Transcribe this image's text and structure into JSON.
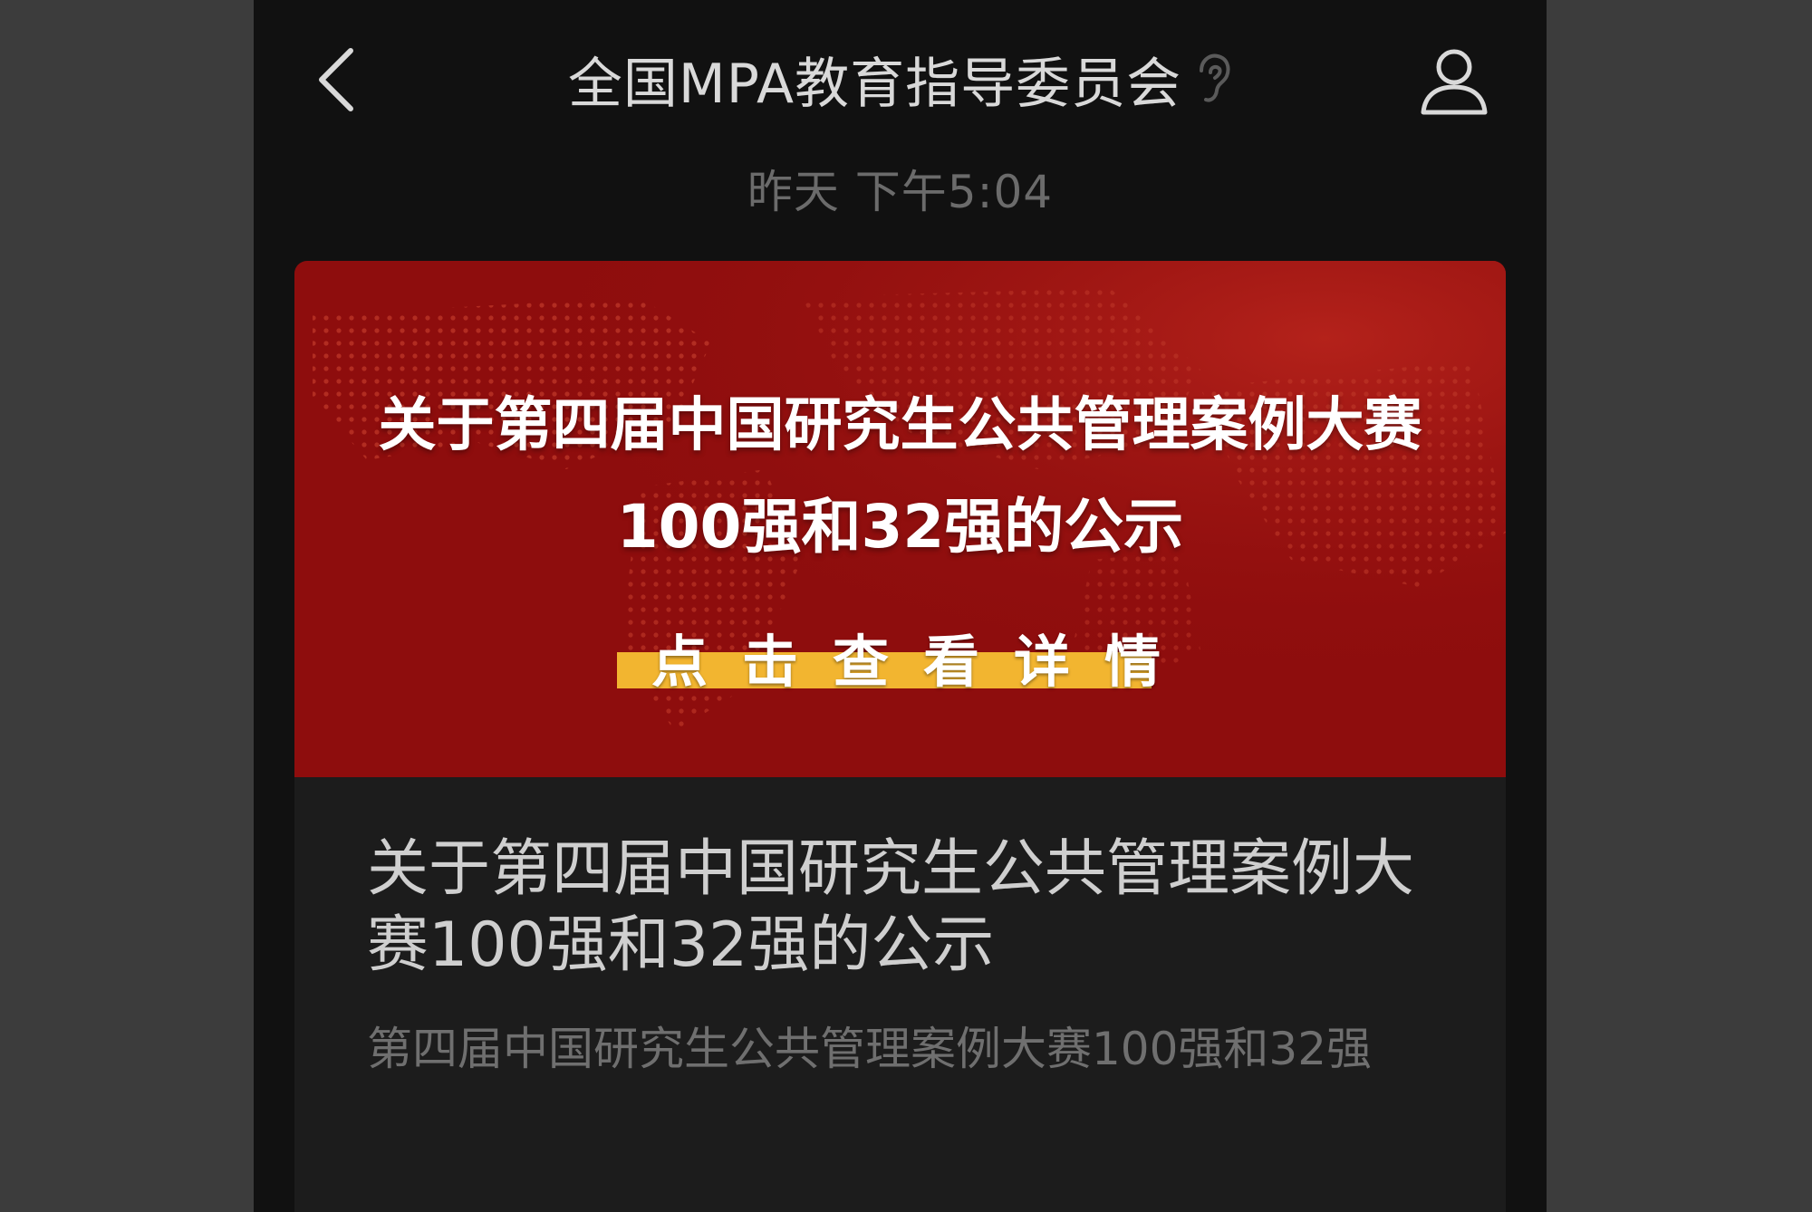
{
  "header": {
    "title": "全国MPA教育指导委员会",
    "back_icon": "chevron-left-icon",
    "listen_icon": "ear-icon",
    "profile_icon": "user-profile-icon"
  },
  "timestamp": "昨天 下午5:04",
  "article": {
    "banner": {
      "line1": "关于第四届中国研究生公共管理案例大赛",
      "line2": "100强和32强的公示",
      "cta": "点击查看详情",
      "background_color": "#8e0d0d",
      "cta_highlight_color": "#f2b530"
    },
    "title": "关于第四届中国研究生公共管理案例大赛100强和32强的公示",
    "summary": "第四届中国研究生公共管理案例大赛100强和32强"
  }
}
